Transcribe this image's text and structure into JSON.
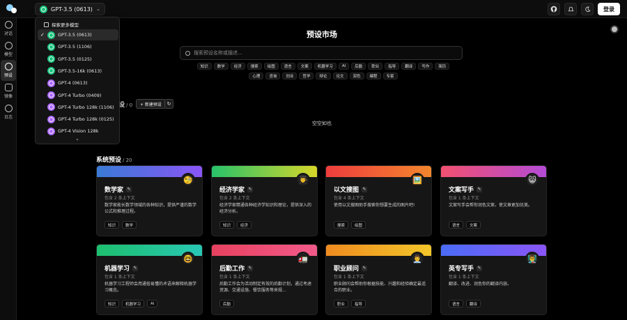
{
  "header": {
    "model_label": "GPT-3.5 (0613)",
    "login_label": "登录"
  },
  "sidebar": {
    "items": [
      {
        "label": "",
        "icon": "chat-icon"
      },
      {
        "label": "对话",
        "icon": "target-icon"
      },
      {
        "label": "模型",
        "icon": "user-icon"
      },
      {
        "label": "预设",
        "icon": "book-icon"
      },
      {
        "label": "",
        "icon": "plugin-icon"
      },
      {
        "label": "镜像",
        "icon": "history-icon"
      },
      {
        "label": "日志",
        "icon": ""
      }
    ]
  },
  "dropdown": {
    "header_label": "探索更多模型",
    "items": [
      {
        "label": "GPT-3.5 (0613)",
        "family": "gpt35",
        "selected": true
      },
      {
        "label": "GPT-3.5 (1106)",
        "family": "gpt35"
      },
      {
        "label": "GPT-3.5 (0125)",
        "family": "gpt35"
      },
      {
        "label": "GPT-3.5-16k (0613)",
        "family": "gpt35"
      },
      {
        "label": "GPT-4 (0613)",
        "family": "gpt4"
      },
      {
        "label": "GPT-4 Turbo (0409)",
        "family": "gpt4"
      },
      {
        "label": "GPT-4 Turbo 128k (1106)",
        "family": "gpt4"
      },
      {
        "label": "GPT-4 Turbo 128k (0125)",
        "family": "gpt4"
      },
      {
        "label": "GPT-4 Vision 128k",
        "family": "gpt4"
      }
    ],
    "more_label": "⌄"
  },
  "main": {
    "title": "预设市场",
    "search_placeholder": "搜索预设名称或描述...",
    "tags_row1": [
      "知识",
      "数学",
      "经济",
      "搜索",
      "绘图",
      "语言",
      "文案",
      "机器学习",
      "AI",
      "后勤",
      "职业",
      "指导",
      "翻译",
      "写作",
      "简历"
    ],
    "tags_row2": [
      "心理",
      "咨询",
      "创业",
      "哲学",
      "辩论",
      "论文",
      "润色",
      "编程",
      "专家"
    ],
    "my_presets": {
      "title": "设",
      "count": "/ 0",
      "new_label": "+ 新建预设",
      "refresh_label": "↻",
      "empty_label": "空空如也"
    },
    "system_presets": {
      "title": "系统预设",
      "count": "/ 20"
    }
  },
  "cards": [
    {
      "title": "数学家",
      "emoji": "🧐",
      "context": "包含 2 条上下文",
      "desc": "数学家能长数学领域的各种知识，提供严谨的数学公式和推理过程。",
      "tags": [
        "知识",
        "数学"
      ],
      "gradient": [
        "#3a7bd5",
        "#8a55f7"
      ]
    },
    {
      "title": "经济学家",
      "emoji": "👨‍🎓",
      "context": "包含 2 条上下文",
      "desc": "经济学家精通各种经济学知识和理论，提供深入的经济分析。",
      "tags": [
        "知识",
        "经济"
      ],
      "gradient": [
        "#27c26a",
        "#d6d62a"
      ]
    },
    {
      "title": "以文搜图",
      "emoji": "🖼️",
      "context": "包含 4 条上下文",
      "desc": "使用以文搜图助手搜索你想要生成的图片吧!",
      "tags": [
        "搜索",
        "绘图"
      ],
      "gradient": [
        "#ef3d3d",
        "#f3862d"
      ]
    },
    {
      "title": "文案写手",
      "emoji": "😸",
      "context": "包含 1 条上下文",
      "desc": "文案写手会帮你润色文案，使文章更加优美。",
      "tags": [
        "语言",
        "文案"
      ],
      "gradient": [
        "#f25070",
        "#b44bd6"
      ]
    },
    {
      "title": "机器学习",
      "emoji": "🤓",
      "context": "包含 1 条上下文",
      "desc": "机器学习工程师会用通俗易懂的术语来解释机器学习概念。",
      "tags": [
        "知识",
        "机器学习",
        "AI"
      ],
      "gradient": [
        "#1dbf6e",
        "#28c7b5"
      ]
    },
    {
      "title": "后勤工作",
      "emoji": "🚛",
      "context": "包含 1 条上下文",
      "desc": "后勤工作会为活动制定有效的后勤计划，通过考虑资源、交通设施、餐饮服务等来规...",
      "tags": [
        "后勤"
      ],
      "gradient": [
        "#e8415f",
        "#f25a8a"
      ]
    },
    {
      "title": "职业顾问",
      "emoji": "👨‍💼",
      "context": "包含 1 条上下文",
      "desc": "职业顾问会帮助你根据技能、兴趣和经验确定最适合的职业。",
      "tags": [
        "职业",
        "指导"
      ],
      "gradient": [
        "#f08b1f",
        "#f2c62a"
      ]
    },
    {
      "title": "英专写手",
      "emoji": "👨‍🏫",
      "context": "包含 1 条上下文",
      "desc": "翻译、改进、润色你的翻译内容。",
      "tags": [
        "语言",
        "翻译"
      ],
      "gradient": [
        "#4a6cf7",
        "#8a55f7"
      ]
    }
  ]
}
